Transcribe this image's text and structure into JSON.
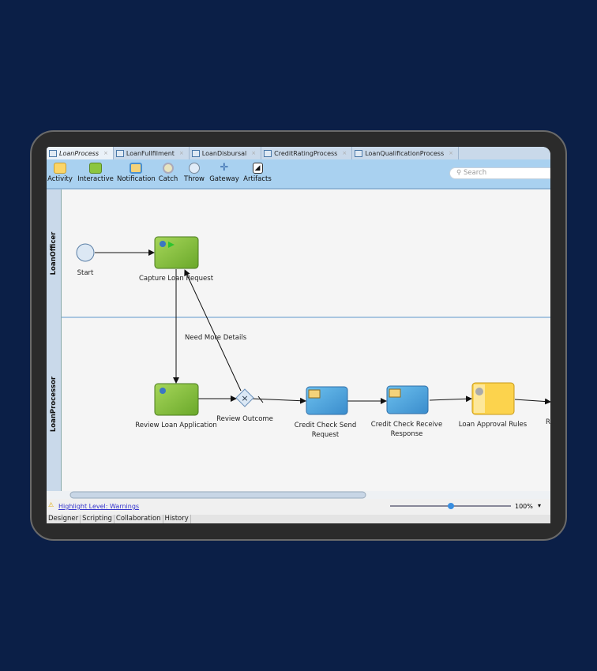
{
  "tabs": [
    {
      "label": "LoanProcess",
      "active": true
    },
    {
      "label": "LoanFullfilment"
    },
    {
      "label": "LoanDisbursal"
    },
    {
      "label": "CreditRatingProcess"
    },
    {
      "label": "LoanQualificationProcess"
    }
  ],
  "toolbar": {
    "items": [
      {
        "label": "Activity",
        "icon": "activity-icon"
      },
      {
        "label": "Interactive",
        "icon": "user-task-icon"
      },
      {
        "label": "Notification",
        "icon": "envelope-icon"
      },
      {
        "label": "Catch",
        "icon": "catch-event-icon"
      },
      {
        "label": "Throw",
        "icon": "throw-event-icon"
      },
      {
        "label": "Gateway",
        "icon": "gateway-icon"
      },
      {
        "label": "Artifacts",
        "icon": "artifacts-icon"
      }
    ],
    "search_placeholder": "Search"
  },
  "lanes": [
    "LoanOfficer",
    "LoanProcessor"
  ],
  "nodes": {
    "start": "Start",
    "capture": "Capture Loan Request",
    "review_app": "Review Loan Application",
    "review_outcome": "Review Outcome",
    "send": [
      "Credit Check Send",
      "Request"
    ],
    "receive": [
      "Credit Check Receive",
      "Response"
    ],
    "rules": "Loan Approval Rules",
    "next": "R"
  },
  "edge_label": "Need More Details",
  "status": {
    "warning": "Highlight Level: Warnings",
    "zoom": "100%",
    "zoom_slider_fraction": 0.5
  },
  "bottom_tabs": [
    "Designer",
    "Scripting",
    "Collaboration",
    "History"
  ],
  "colors": {
    "background": "#0b1f47",
    "toolbar": "#a9d1f0",
    "user_task": "#8cc63f",
    "service_task": "#4aa3df",
    "rules_task": "#fcd34d"
  }
}
